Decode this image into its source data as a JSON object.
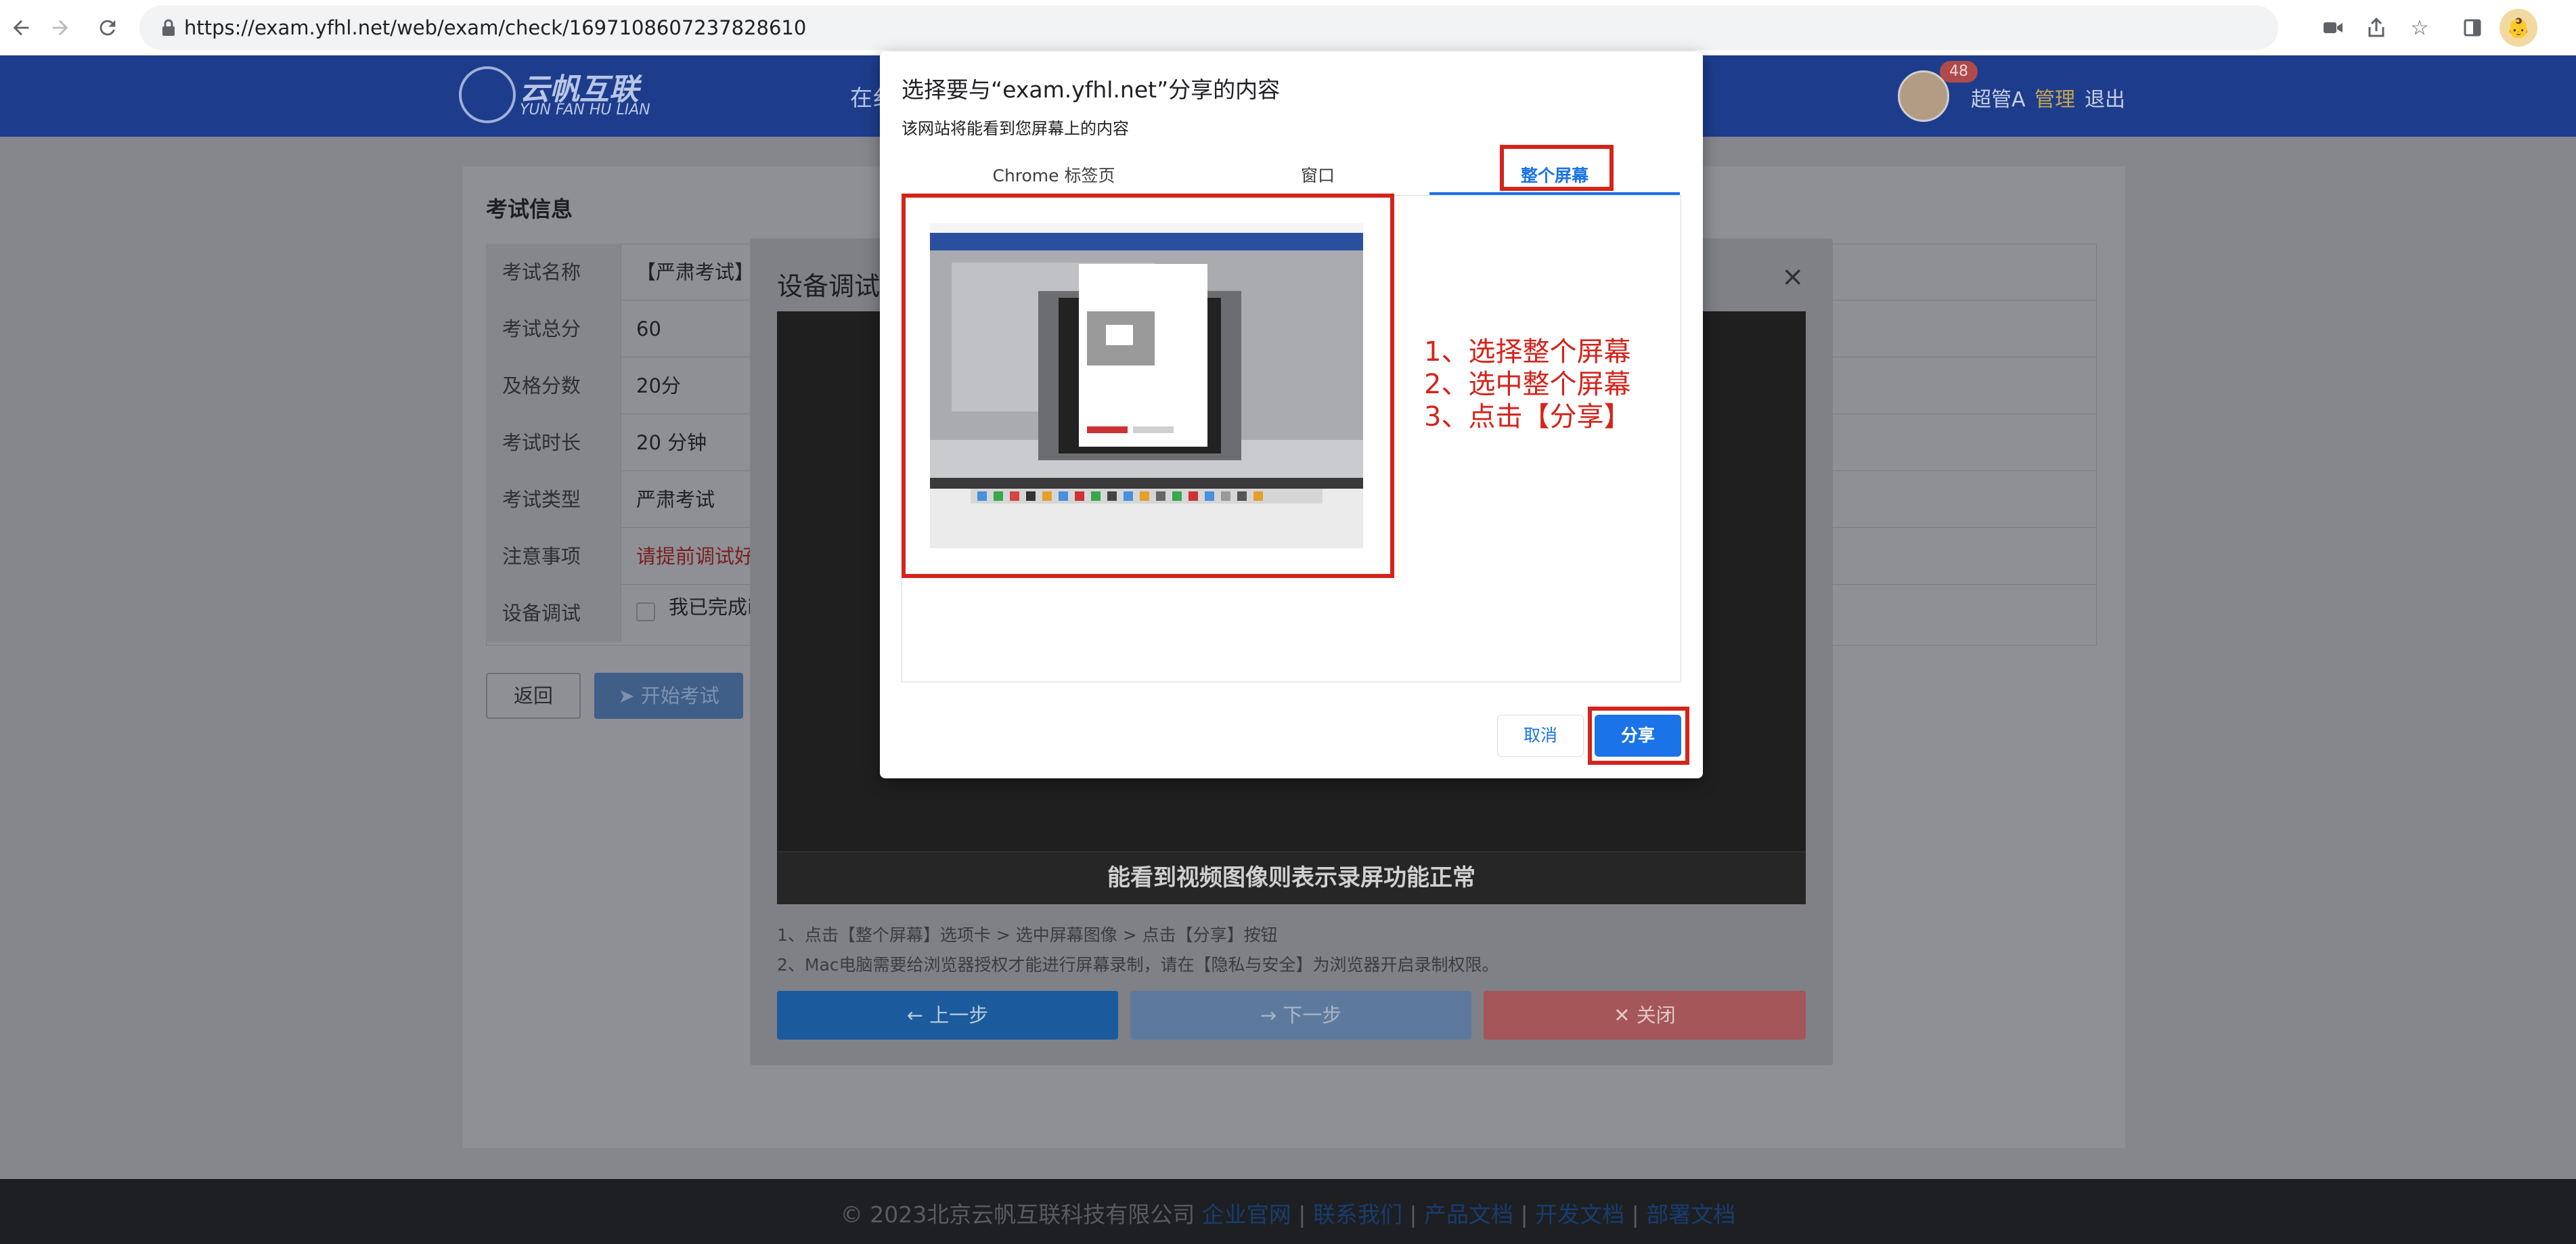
{
  "browser": {
    "url": "https://exam.yfhl.net/web/exam/check/1697108607237828610",
    "nav_icons": [
      "back-arrow-icon",
      "forward-arrow-icon",
      "reload-icon"
    ],
    "toolbar_icons": [
      "camera-icon",
      "share-icon",
      "star-icon",
      "side-panel-icon",
      "profile-avatar"
    ]
  },
  "header": {
    "logo_cn": "云帆互联",
    "logo_en": "YUN FAN HU LIAN",
    "nav_fragment": "在纟",
    "badge_count": "48",
    "user_name": "超管A",
    "admin_link": "管理",
    "logout_link": "退出"
  },
  "exam_info": {
    "title": "考试信息",
    "rows": [
      {
        "label": "考试名称",
        "value": "【严肃考试】"
      },
      {
        "label": "考试总分",
        "value": "60"
      },
      {
        "label": "及格分数",
        "value": "20分"
      },
      {
        "label": "考试时长",
        "value": "20 分钟"
      },
      {
        "label": "考试类型",
        "value": "严肃考试"
      },
      {
        "label": "注意事项",
        "value": "请提前调试好"
      },
      {
        "label": "设备调试",
        "value": "我已完成i"
      }
    ],
    "back_label": "返回",
    "start_label": "开始考试"
  },
  "device_modal": {
    "title": "设备调试",
    "preview_caption": "能看到视频图像则表示录屏功能正常",
    "tip1": "1、点击【整个屏幕】选项卡 > 选中屏幕图像 > 点击【分享】按钮",
    "tip2": "2、Mac电脑需要给浏览器授权才能进行屏幕录制，请在【隐私与安全】为浏览器开启录制权限。",
    "prev_label": "← 上一步",
    "next_label": "→ 下一步",
    "close_label": "✕ 关闭"
  },
  "share_dialog": {
    "title": "选择要与“exam.yfhl.net”分享的内容",
    "subtitle": "该网站将能看到您屏幕上的内容",
    "tabs": [
      "Chrome 标签页",
      "窗口",
      "整个屏幕"
    ],
    "active_tab": "整个屏幕",
    "instructions": [
      "1、选择整个屏幕",
      "2、选中整个屏幕",
      "3、点击【分享】"
    ],
    "cancel_label": "取消",
    "share_label": "分享"
  },
  "footer": {
    "copyright": "© 2023北京云帆互联科技有限公司",
    "links": [
      "企业官网",
      "联系我们",
      "产品文档",
      "开发文档",
      "部署文档"
    ]
  },
  "colors": {
    "annotation_red": "#d4241b",
    "chrome_blue": "#1a73e8",
    "header_blue": "#1d3d8c"
  }
}
